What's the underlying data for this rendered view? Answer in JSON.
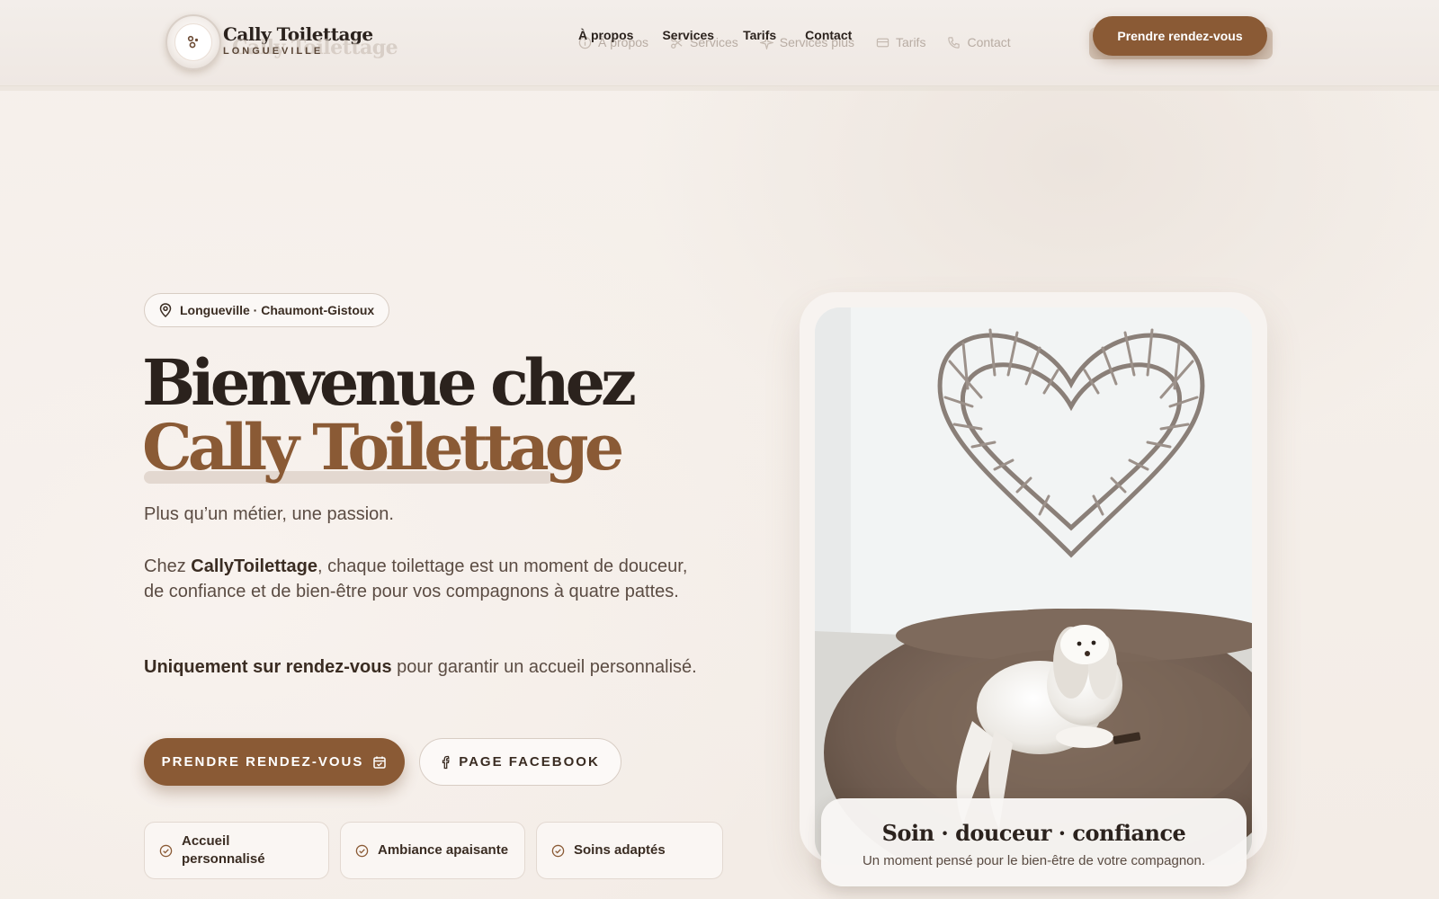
{
  "brand": {
    "name": "Cally Toilettage",
    "subtitle": "LONGUEVILLE",
    "ghost_name": "Cally Toilettage"
  },
  "nav": {
    "items": [
      {
        "label": "À propos"
      },
      {
        "label": "Services"
      },
      {
        "label": "Tarifs"
      },
      {
        "label": "Contact"
      }
    ],
    "ghost_items": [
      {
        "label": "À propos",
        "icon": "info-icon"
      },
      {
        "label": "Services",
        "icon": "scissors-icon"
      },
      {
        "label": "Services plus",
        "icon": "sparkle-icon"
      },
      {
        "label": "Tarifs",
        "icon": "card-icon"
      },
      {
        "label": "Contact",
        "icon": "phone-icon"
      }
    ],
    "cta_label": "Prendre rendez-vous"
  },
  "hero": {
    "location": "Longueville · Chaumont-Gistoux",
    "title_line1": "Bienvenue chez",
    "title_line2": "Cally Toilettage",
    "tagline": "Plus qu’un métier, une passion.",
    "para_prefix": "Chez ",
    "para_bold": "CallyToilettage",
    "para_suffix": ", chaque toilettage est un moment de douceur, de confiance et de bien-être pour vos compagnons à quatre pattes.",
    "para2_bold": "Uniquement sur rendez-vous",
    "para2_suffix": " pour garantir un accueil personnalisé.",
    "primary_button": "PRENDRE RENDEZ-VOUS",
    "secondary_button": "PAGE FACEBOOK",
    "features": [
      {
        "label": "Accueil personnalisé"
      },
      {
        "label": "Ambiance apaisante"
      },
      {
        "label": "Soins adaptés"
      }
    ]
  },
  "photo": {
    "caption_title": "Soin · douceur · confiance",
    "caption_subtitle": "Un moment pensé pour le bien-être de votre compagnon."
  },
  "colors": {
    "accent": "#8a5a35",
    "text_dark": "#2b221d",
    "text_muted": "#5b4c43",
    "background": "#f5efea"
  }
}
